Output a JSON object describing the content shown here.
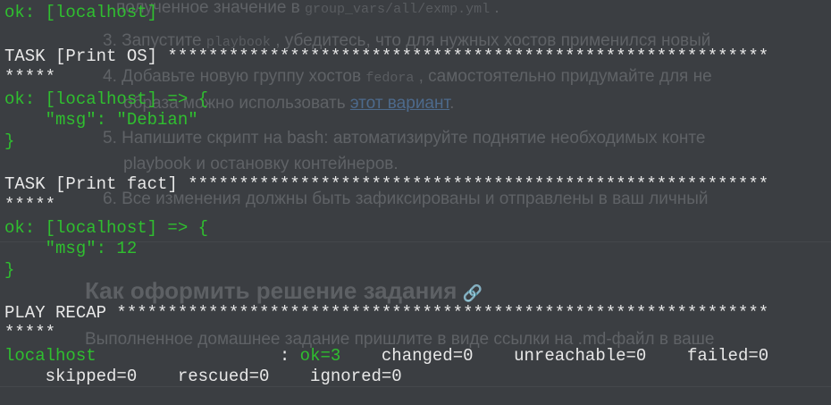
{
  "page": {
    "line0_text": "полученное значение в ",
    "line0_code": "group_vars/all/exmp.yml",
    "line0_end": " .",
    "item3_pre": "3. Запустите ",
    "item3_code": "playbook",
    "item3_post": " , убедитесь, что для нужных хостов применился новый",
    "item4_pre": "4. Добавьте новую группу хостов ",
    "item4_code": "fedora",
    "item4_post": " , самостоятельно придумайте для не",
    "item4_cont_pre": "образа можно использовать ",
    "item4_link": "этот вариант",
    "item4_cont_post": ".",
    "item5": "5. Напишите скрипт на bash: автоматизируйте поднятие необходимых конте",
    "item5_cont": "playbook и остановку контейнеров.",
    "item6": "6. Все изменения должны быть зафиксированы и отправлены в ваш личный",
    "heading": "Как оформить решение задания",
    "heading_icon": "🔗",
    "paragraph": "Выполненное домашнее задание пришлите в виде ссылки на .md-файл в ваше"
  },
  "terminal": {
    "l1": "ok: [localhost]",
    "task_os": "TASK [Print OS] ***********************************************************",
    "stars": "*****",
    "ok_arrow": "ok: [localhost] => {",
    "msg_os": "    \"msg\": \"Debian\"",
    "close": "}",
    "task_fact": "TASK [Print fact] *********************************************************",
    "msg_fact": "    \"msg\": 12",
    "recap": "PLAY RECAP ****************************************************************",
    "host": "localhost",
    "colon": "                  : ",
    "ok_count": "ok=3",
    "recap_rest": "    changed=0    unreachable=0    failed=0",
    "recap_line2": "    skipped=0    rescued=0    ignored=0"
  }
}
